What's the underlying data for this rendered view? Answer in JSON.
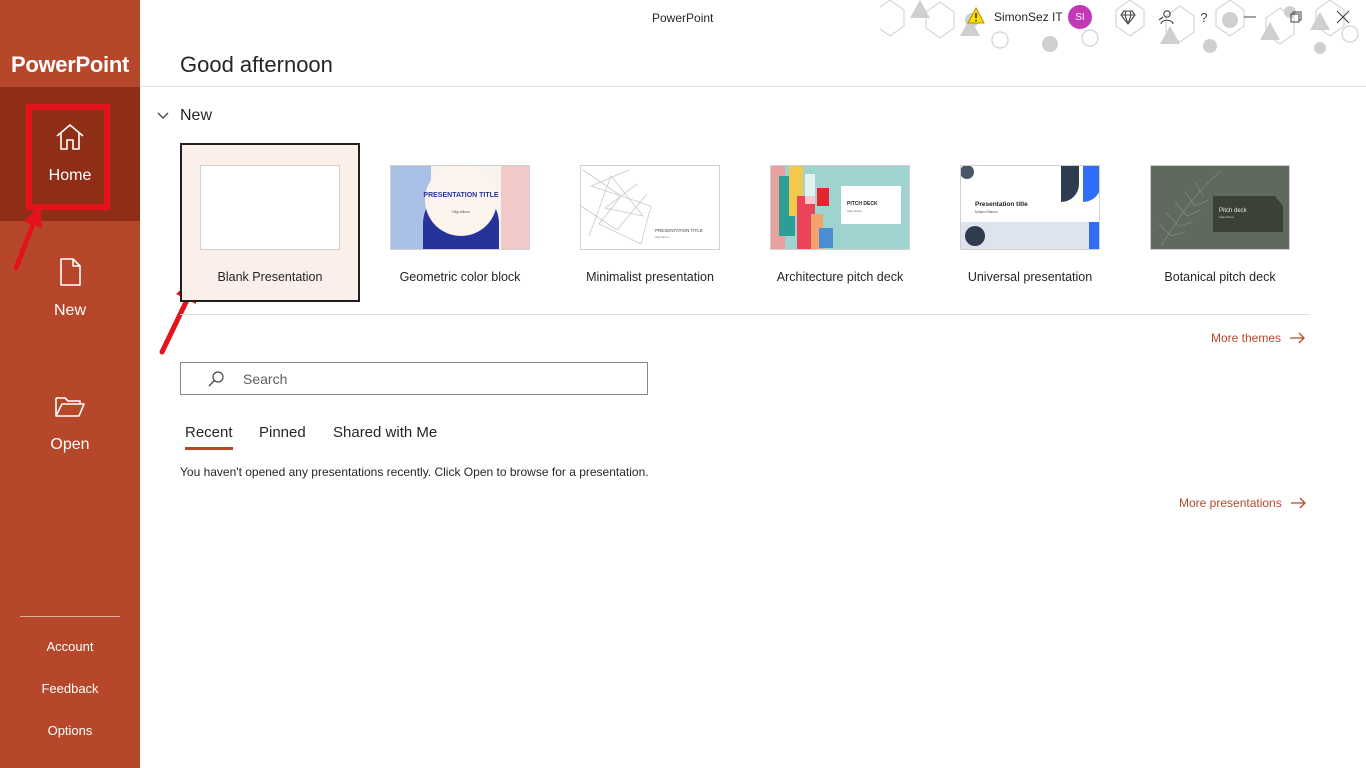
{
  "app": {
    "name": "PowerPoint",
    "window_title": "PowerPoint"
  },
  "user": {
    "name": "SimonSez IT",
    "initials": "SI"
  },
  "sidebar": {
    "nav": [
      {
        "label": "Home",
        "icon": "home-icon",
        "active": true
      },
      {
        "label": "New",
        "icon": "new-file-icon",
        "active": false
      },
      {
        "label": "Open",
        "icon": "open-folder-icon",
        "active": false
      }
    ],
    "bottom": [
      "Account",
      "Feedback",
      "Options"
    ]
  },
  "main": {
    "greeting": "Good afternoon",
    "new_section_label": "New",
    "templates": [
      {
        "name": "Blank Presentation",
        "selected": true
      },
      {
        "name": "Geometric color block",
        "thumb_title": "PRESENTATION TITLE",
        "thumb_sub": "Hilja Allison"
      },
      {
        "name": "Minimalist presentation",
        "thumb_title": "PRESENTATION TITLE",
        "thumb_sub": "Hilja Allison"
      },
      {
        "name": "Architecture pitch deck",
        "thumb_title": "PITCH DECK",
        "thumb_sub": "Hilja Allison"
      },
      {
        "name": "Universal presentation",
        "thumb_title": "Presentation title",
        "thumb_sub": "Mirjam Nilsson"
      },
      {
        "name": "Botanical pitch deck",
        "thumb_title": "Pitch deck",
        "thumb_sub": "Hilja Allison"
      }
    ],
    "more_themes": "More themes",
    "search_placeholder": "Search",
    "tabs": [
      "Recent",
      "Pinned",
      "Shared with Me"
    ],
    "active_tab": "Recent",
    "empty_message": "You haven't opened any presentations recently. Click Open to browse for a presentation.",
    "more_presentations": "More presentations"
  },
  "colors": {
    "brand": "#b7472a",
    "brand_dark": "#8e2e17",
    "annotation": "#e3131b",
    "avatar": "#c239b3"
  }
}
